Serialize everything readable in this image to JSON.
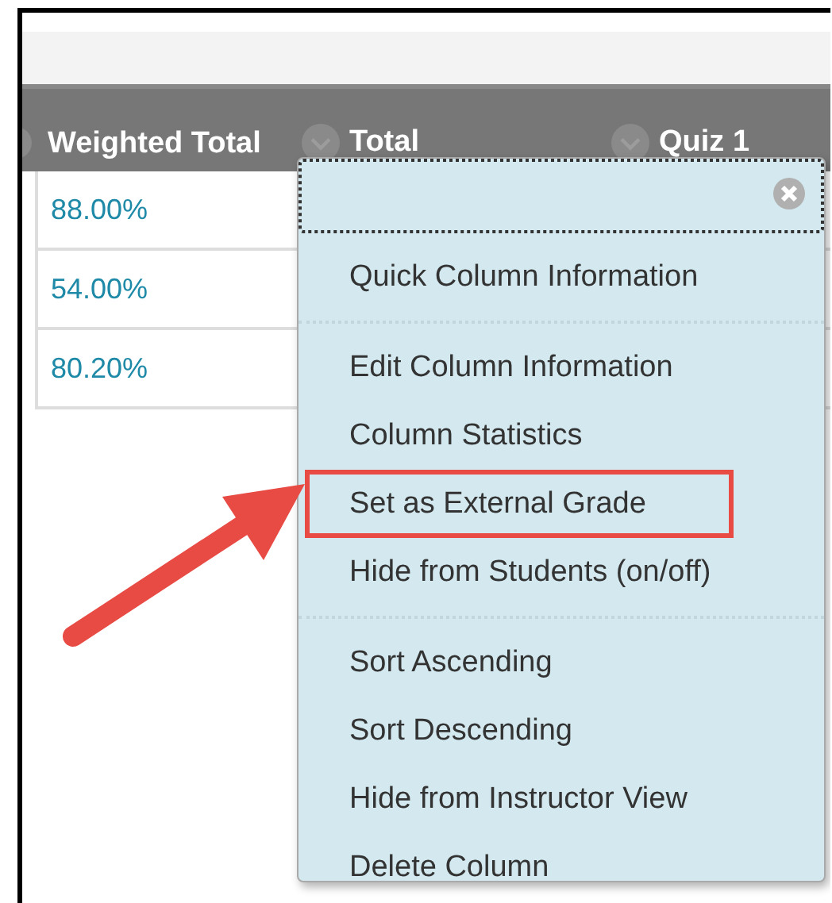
{
  "columns": [
    {
      "label": "Weighted Total"
    },
    {
      "label": "Total"
    },
    {
      "label": "Quiz 1"
    }
  ],
  "rows": [
    {
      "cells": [
        "88.00%"
      ]
    },
    {
      "cells": [
        "54.00%"
      ]
    },
    {
      "cells": [
        "80.20%"
      ]
    }
  ],
  "menu": {
    "sections": [
      {
        "items": [
          {
            "label": "Quick Column Information",
            "annotated": false
          }
        ]
      },
      {
        "items": [
          {
            "label": "Edit Column Information",
            "annotated": false
          },
          {
            "label": "Column Statistics",
            "annotated": false
          },
          {
            "label": "Set as External Grade",
            "annotated": true
          },
          {
            "label": "Hide from Students (on/off)",
            "annotated": false
          }
        ]
      },
      {
        "items": [
          {
            "label": "Sort Ascending",
            "annotated": false
          },
          {
            "label": "Sort Descending",
            "annotated": false
          },
          {
            "label": "Hide from Instructor View",
            "annotated": false
          },
          {
            "label": "Delete Column",
            "annotated": false
          }
        ]
      }
    ]
  }
}
